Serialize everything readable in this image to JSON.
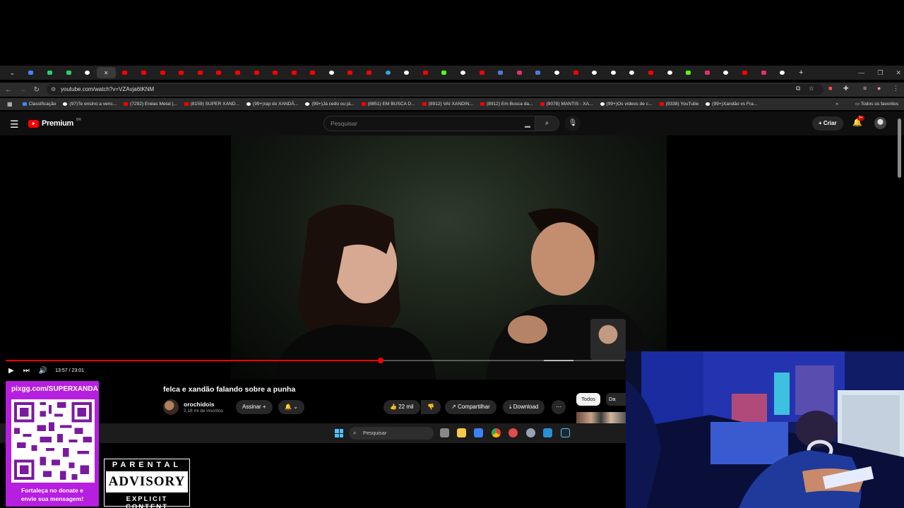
{
  "browser": {
    "url": "youtube.com/watch?v=VZAvja6tKNM",
    "tab_close_glyph": "✕",
    "new_tab_glyph": "+",
    "bookmarks": [
      {
        "label": "Classificação",
        "icon": "google-icon"
      },
      {
        "label": "(97)Te ensino a venc...",
        "icon": "tiktok-icon"
      },
      {
        "label": "(7292) Enéas Metal |...",
        "icon": "youtube-icon"
      },
      {
        "label": "(8159) SUPER XAND...",
        "icon": "youtube-icon"
      },
      {
        "label": "(99+)rap do XANDÃ...",
        "icon": "tiktok-icon"
      },
      {
        "label": "(99+)Já cedo ou já...",
        "icon": "tiktok-icon"
      },
      {
        "label": "(8851) EM BUSCA D...",
        "icon": "youtube-icon"
      },
      {
        "label": "(8912) VAI XANDIN...",
        "icon": "youtube-icon"
      },
      {
        "label": "(8912) Em Busca da...",
        "icon": "youtube-icon"
      },
      {
        "label": "(9078) MANTIS - XA...",
        "icon": "youtube-icon"
      },
      {
        "label": "(99+)Os vídeos de c...",
        "icon": "tiktok-icon"
      },
      {
        "label": "(9338) YouTube",
        "icon": "youtube-icon"
      },
      {
        "label": "(99+)Xandão vs Fra...",
        "icon": "tiktok-icon"
      }
    ],
    "all_bookmarks": "Todos os favoritos"
  },
  "youtube": {
    "logo_text": "Premium",
    "logo_region": "BR",
    "search_placeholder": "Pesquisar",
    "create_label": "Criar",
    "notif_badge": "9+",
    "player": {
      "time": "13:57 / 23:01",
      "progress_fraction": 0.606
    },
    "video_title": "felca e xandão falando sobre a punha",
    "channel_name": "orochidois",
    "channel_subs": "2,18 mi de inscritos",
    "subscribe_label": "Assinar",
    "likes": "22 mil",
    "share_label": "Compartilhar",
    "download_label": "Download",
    "chips": [
      "Todos",
      "Da sua"
    ]
  },
  "taskbar": {
    "search_label": "Pesquisar"
  },
  "overlay": {
    "donate_url": "pixgg.com/SUPERXANDÃ",
    "donate_caption_1": "Fortaleça no donate e",
    "donate_caption_2": "envie sua mensagem!",
    "advisory_1": "PARENTAL",
    "advisory_2": "ADVISORY",
    "advisory_3": "EXPLICIT CONTENT"
  },
  "colors": {
    "youtube_red": "#ff0000",
    "qr_panel": "#b61ee0",
    "page_bg": "#0f0f0f"
  }
}
